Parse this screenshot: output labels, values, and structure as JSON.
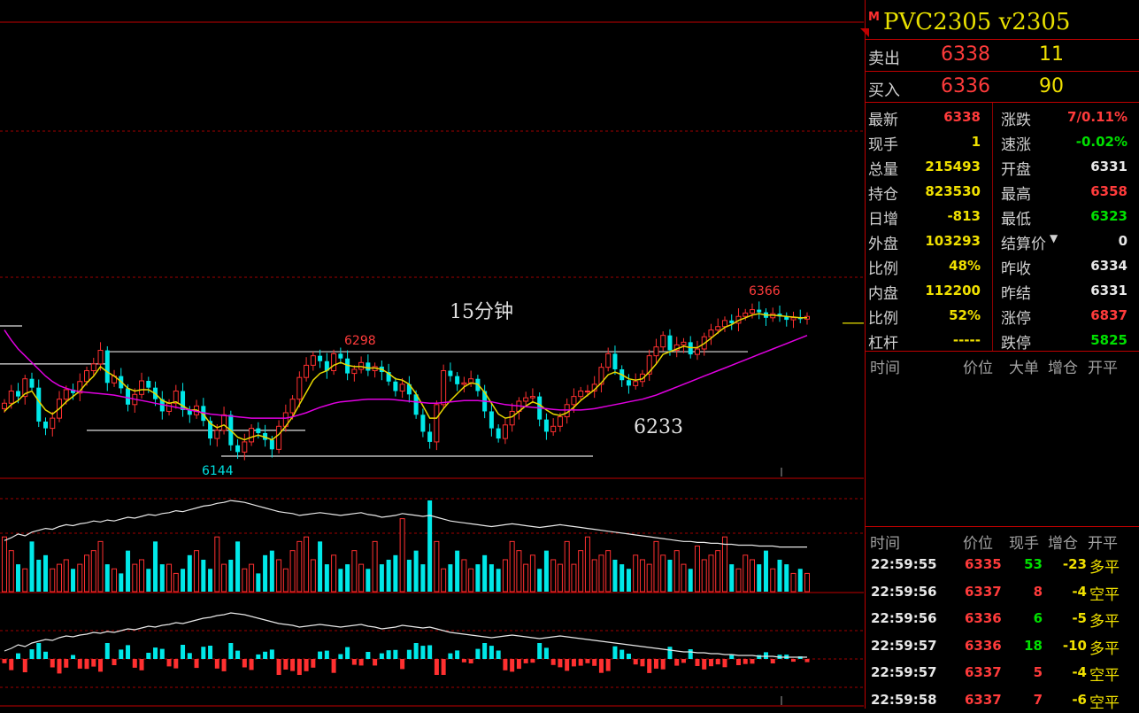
{
  "chart_data": [
    {
      "type": "candlestick",
      "title": "15分钟",
      "annotations": [
        "6298",
        "6366",
        "6144",
        "6233"
      ],
      "levels": [
        6298,
        6144,
        6233
      ],
      "price_range": [
        6120,
        6420
      ],
      "series": [
        {
          "name": "close",
          "values": [
            6222,
            6240,
            6232,
            6258,
            6245,
            6195,
            6185,
            6200,
            6228,
            6242,
            6237,
            6254,
            6270,
            6280,
            6300,
            6252,
            6262,
            6244,
            6220,
            6235,
            6255,
            6245,
            6228,
            6210,
            6222,
            6240,
            6212,
            6205,
            6218,
            6196,
            6170,
            6182,
            6205,
            6160,
            6150,
            6165,
            6185,
            6178,
            6168,
            6154,
            6188,
            6208,
            6228,
            6260,
            6278,
            6292,
            6284,
            6270,
            6295,
            6288,
            6266,
            6272,
            6282,
            6270,
            6276,
            6268,
            6254,
            6240,
            6250,
            6235,
            6205,
            6180,
            6165,
            6220,
            6270,
            6262,
            6250,
            6252,
            6258,
            6240,
            6210,
            6185,
            6170,
            6190,
            6210,
            6225,
            6230,
            6232,
            6198,
            6180,
            6188,
            6202,
            6220,
            6232,
            6240,
            6240,
            6250,
            6275,
            6295,
            6272,
            6256,
            6248,
            6254,
            6265,
            6292,
            6305,
            6322,
            6300,
            6308,
            6312,
            6294,
            6302,
            6320,
            6330,
            6335,
            6344,
            6340,
            6350,
            6355,
            6360,
            6356,
            6348,
            6354,
            6350,
            6345,
            6348,
            6346,
            6350
          ]
        },
        {
          "name": "ma_short",
          "values": [
            6210,
            6220,
            6226,
            6236,
            6240,
            6225,
            6212,
            6206,
            6214,
            6224,
            6232,
            6240,
            6252,
            6262,
            6276,
            6268,
            6262,
            6254,
            6244,
            6240,
            6242,
            6242,
            6236,
            6226,
            6222,
            6224,
            6218,
            6212,
            6212,
            6206,
            6192,
            6186,
            6190,
            6182,
            6172,
            6168,
            6172,
            6175,
            6172,
            6168,
            6176,
            6188,
            6202,
            6220,
            6238,
            6256,
            6266,
            6270,
            6278,
            6282,
            6278,
            6276,
            6276,
            6274,
            6274,
            6272,
            6266,
            6258,
            6256,
            6250,
            6236,
            6218,
            6200,
            6200,
            6214,
            6226,
            6236,
            6246,
            6252,
            6250,
            6238,
            6222,
            6206,
            6200,
            6202,
            6210,
            6218,
            6224,
            6220,
            6212,
            6206,
            6204,
            6208,
            6216,
            6226,
            6234,
            6242,
            6252,
            6264,
            6268,
            6264,
            6258,
            6256,
            6258,
            6268,
            6280,
            6294,
            6298,
            6302,
            6306,
            6304,
            6304,
            6310,
            6318,
            6326,
            6334,
            6338,
            6344,
            6348,
            6352,
            6354,
            6352,
            6352,
            6351,
            6350,
            6349,
            6348,
            6348
          ]
        },
        {
          "name": "ma_long",
          "values": [
            6330,
            6315,
            6302,
            6292,
            6282,
            6272,
            6262,
            6254,
            6248,
            6244,
            6241,
            6239,
            6238,
            6237,
            6236,
            6235,
            6234,
            6232,
            6230,
            6228,
            6226,
            6224,
            6222,
            6220,
            6218,
            6216,
            6214,
            6212,
            6210,
            6208,
            6206,
            6205,
            6204,
            6203,
            6202,
            6201,
            6200,
            6200,
            6200,
            6200,
            6200,
            6200,
            6202,
            6205,
            6208,
            6212,
            6216,
            6219,
            6222,
            6224,
            6225,
            6226,
            6227,
            6228,
            6228,
            6228,
            6228,
            6227,
            6226,
            6225,
            6224,
            6223,
            6222,
            6222,
            6223,
            6224,
            6225,
            6226,
            6226,
            6226,
            6225,
            6224,
            6222,
            6220,
            6219,
            6218,
            6217,
            6216,
            6215,
            6214,
            6213,
            6212,
            6212,
            6212,
            6212,
            6213,
            6214,
            6216,
            6218,
            6220,
            6222,
            6224,
            6226,
            6228,
            6231,
            6234,
            6238,
            6242,
            6246,
            6250,
            6254,
            6258,
            6262,
            6266,
            6270,
            6274,
            6278,
            6282,
            6286,
            6290,
            6294,
            6298,
            6302,
            6306,
            6310,
            6314,
            6318,
            6322
          ]
        }
      ]
    },
    {
      "type": "bar",
      "title": "",
      "series": [
        {
          "name": "volume",
          "values": [
            60,
            45,
            30,
            25,
            55,
            35,
            40,
            25,
            30,
            35,
            25,
            30,
            40,
            45,
            55,
            30,
            25,
            20,
            45,
            30,
            35,
            25,
            55,
            30,
            30,
            20,
            25,
            40,
            45,
            35,
            25,
            60,
            30,
            35,
            55,
            25,
            30,
            20,
            40,
            45,
            35,
            25,
            45,
            55,
            60,
            35,
            55,
            30,
            40,
            25,
            30,
            45,
            30,
            25,
            55,
            30,
            35,
            40,
            80,
            35,
            45,
            30,
            100,
            55,
            25,
            30,
            45,
            35,
            25,
            30,
            40,
            30,
            25,
            35,
            55,
            45,
            30,
            40,
            25,
            45,
            35,
            30,
            55,
            30,
            45,
            60,
            35,
            40,
            45,
            35,
            30,
            25,
            40,
            35,
            30,
            55,
            40,
            35,
            45,
            30,
            25,
            50,
            35,
            40,
            45,
            60,
            30,
            25,
            40,
            35,
            30,
            45,
            25,
            35,
            30,
            20,
            25,
            20
          ]
        },
        {
          "name": "open_interest",
          "values": [
            55,
            58,
            62,
            60,
            64,
            66,
            68,
            67,
            70,
            72,
            71,
            73,
            74,
            76,
            75,
            77,
            76,
            78,
            80,
            79,
            81,
            83,
            82,
            84,
            85,
            87,
            86,
            88,
            90,
            92,
            93,
            95,
            96,
            98,
            97,
            96,
            94,
            92,
            90,
            88,
            86,
            85,
            84,
            82,
            83,
            84,
            85,
            84,
            83,
            82,
            83,
            84,
            85,
            83,
            82,
            80,
            81,
            82,
            84,
            83,
            82,
            81,
            82,
            80,
            78,
            76,
            75,
            74,
            73,
            72,
            71,
            70,
            71,
            72,
            73,
            72,
            71,
            70,
            69,
            70,
            71,
            72,
            71,
            70,
            69,
            68,
            67,
            66,
            65,
            64,
            63,
            62,
            61,
            60,
            59,
            58,
            57,
            56,
            55,
            54,
            54,
            53,
            53,
            52,
            52,
            51,
            51,
            50,
            50,
            50,
            49,
            49,
            49,
            48,
            48,
            48,
            48,
            48
          ]
        }
      ]
    }
  ],
  "panel": {
    "m_badge": "M",
    "title": "PVC2305  v2305",
    "sell_label": "卖出",
    "sell_price": "6338",
    "sell_vol": "11",
    "buy_label": "买入",
    "buy_price": "6336",
    "buy_vol": "90",
    "stats_left": [
      {
        "label": "最新",
        "value": "6338",
        "color": "#ff3b3b"
      },
      {
        "label": "现手",
        "value": "1",
        "color": "#f0e000"
      },
      {
        "label": "总量",
        "value": "215493",
        "color": "#f0e000"
      },
      {
        "label": "持仓",
        "value": "823530",
        "color": "#f0e000"
      },
      {
        "label": "日增",
        "value": "-813",
        "color": "#f0e000"
      },
      {
        "label": "外盘",
        "value": "103293",
        "color": "#f0e000"
      },
      {
        "label": "比例",
        "value": "48%",
        "color": "#f0e000"
      },
      {
        "label": "内盘",
        "value": "112200",
        "color": "#f0e000"
      },
      {
        "label": "比例",
        "value": "52%",
        "color": "#f0e000"
      },
      {
        "label": "杠杆",
        "value": "-----",
        "color": "#f0e000"
      }
    ],
    "stats_right": [
      {
        "label": "涨跌",
        "value": "7/0.11%",
        "color": "#ff3b3b"
      },
      {
        "label": "速涨",
        "value": "-0.02%",
        "color": "#00e000"
      },
      {
        "label": "开盘",
        "value": "6331",
        "color": "#e8e8e8"
      },
      {
        "label": "最高",
        "value": "6358",
        "color": "#ff3b3b"
      },
      {
        "label": "最低",
        "value": "6323",
        "color": "#00e000"
      },
      {
        "label": "结算价",
        "value": "0",
        "color": "#e8e8e8"
      },
      {
        "label": "昨收",
        "value": "6334",
        "color": "#e8e8e8"
      },
      {
        "label": "昨结",
        "value": "6331",
        "color": "#e8e8e8"
      },
      {
        "label": "涨停",
        "value": "6837",
        "color": "#ff3b3b"
      },
      {
        "label": "跌停",
        "value": "5825",
        "color": "#00e000"
      }
    ],
    "big_header": {
      "time": "时间",
      "price": "价位",
      "big": "大单",
      "oi": "增仓",
      "oc": "开平"
    },
    "tick_header": {
      "time": "时间",
      "price": "价位",
      "vol": "现手",
      "oi": "增仓",
      "oc": "开平"
    },
    "ticks": [
      {
        "time": "22:59:55",
        "price": "6335",
        "vol": "53",
        "oi": "-23",
        "oc": "多平",
        "vol_color": "#00e000"
      },
      {
        "time": "22:59:56",
        "price": "6337",
        "vol": "8",
        "oi": "-4",
        "oc": "空平",
        "vol_color": "#ff3b3b"
      },
      {
        "time": "22:59:56",
        "price": "6336",
        "vol": "6",
        "oi": "-5",
        "oc": "多平",
        "vol_color": "#00e000"
      },
      {
        "time": "22:59:57",
        "price": "6336",
        "vol": "18",
        "oi": "-10",
        "oc": "多平",
        "vol_color": "#00e000"
      },
      {
        "time": "22:59:57",
        "price": "6337",
        "vol": "5",
        "oi": "-4",
        "oc": "空平",
        "vol_color": "#ff3b3b"
      },
      {
        "time": "22:59:58",
        "price": "6337",
        "vol": "7",
        "oi": "-6",
        "oc": "空平",
        "vol_color": "#ff3b3b"
      }
    ]
  }
}
